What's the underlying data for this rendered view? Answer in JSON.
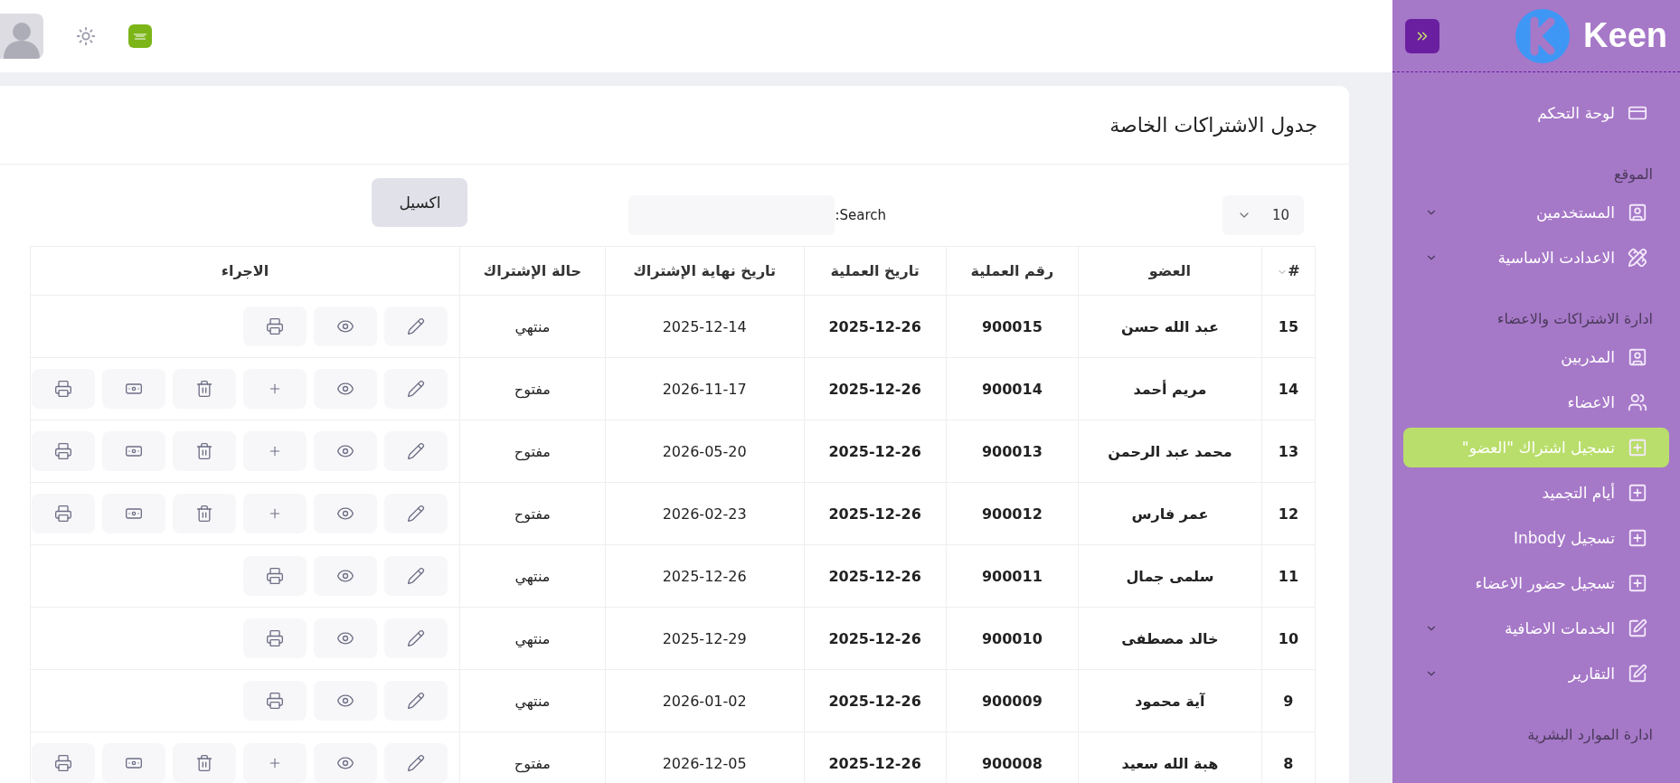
{
  "sidebar": {
    "brand": "Keen",
    "items": [
      {
        "kind": "dashboard",
        "label": "لوحة التحكم",
        "selected": false
      },
      {
        "kind": "header",
        "label": "الموقع"
      },
      {
        "kind": "contacts",
        "label": "المستخدمين",
        "selected": false,
        "expanded": false
      },
      {
        "kind": "settings",
        "label": "الاعدادت الاساسية",
        "selected": false,
        "expanded": false
      },
      {
        "kind": "header",
        "label": "ادارة الاشتراكات والاعضاء"
      },
      {
        "kind": "contacts",
        "label": "المدربين",
        "selected": false
      },
      {
        "kind": "people",
        "label": "الاعضاء",
        "selected": false
      },
      {
        "kind": "add",
        "label": "تسجيل اشتراك \"العضو\"",
        "selected": true
      },
      {
        "kind": "add",
        "label": "أيام التجميد",
        "selected": false
      },
      {
        "kind": "add",
        "label": "تسجيل Inbody",
        "selected": false
      },
      {
        "kind": "add",
        "label": "تسجيل حضور الاعضاء",
        "selected": false
      },
      {
        "kind": "edit",
        "label": "الخدمات الاضافية",
        "selected": false,
        "expanded": false
      },
      {
        "kind": "edit",
        "label": "التقارير",
        "selected": false,
        "expanded": false
      },
      {
        "kind": "header",
        "label": "ادارة الموارد البشرية"
      }
    ]
  },
  "card": {
    "title": "جدول الاشتراكات الخاصة",
    "page_size": "10",
    "search": {
      "label": "Search:"
    },
    "export_button": "اكسيل",
    "table": {
      "columns": [
        "#",
        "العضو",
        "رقم العملية",
        "تاريخ العملية",
        "تاريخ نهاية الإشتراك",
        "حالة الإشتراك",
        "الاجراء"
      ],
      "rows": [
        {
          "kind": "closed",
          "cells": [
            "15",
            "عبد الله حسن",
            "900015",
            "2025-12-26",
            "2025-12-14",
            "منتهي"
          ]
        },
        {
          "kind": "open",
          "cells": [
            "14",
            "مريم أحمد",
            "900014",
            "2025-12-26",
            "2026-11-17",
            "مفتوح"
          ]
        },
        {
          "kind": "open",
          "cells": [
            "13",
            "محمد عبد الرحمن",
            "900013",
            "2025-12-26",
            "2026-05-20",
            "مفتوح"
          ]
        },
        {
          "kind": "open",
          "cells": [
            "12",
            "عمر فارس",
            "900012",
            "2025-12-26",
            "2026-02-23",
            "مفتوح"
          ]
        },
        {
          "kind": "closed",
          "cells": [
            "11",
            "سلمى جمال",
            "900011",
            "2025-12-26",
            "2025-12-26",
            "منتهي"
          ]
        },
        {
          "kind": "closed",
          "cells": [
            "10",
            "خالد مصطفى",
            "900010",
            "2025-12-26",
            "2025-12-29",
            "منتهي"
          ]
        },
        {
          "kind": "closed",
          "cells": [
            "9",
            "آية محمود",
            "900009",
            "2025-12-26",
            "2026-01-02",
            "منتهي"
          ]
        },
        {
          "kind": "open",
          "cells": [
            "8",
            "هبة الله سعيد",
            "900008",
            "2025-12-26",
            "2026-12-05",
            "مفتوح"
          ]
        }
      ]
    }
  }
}
